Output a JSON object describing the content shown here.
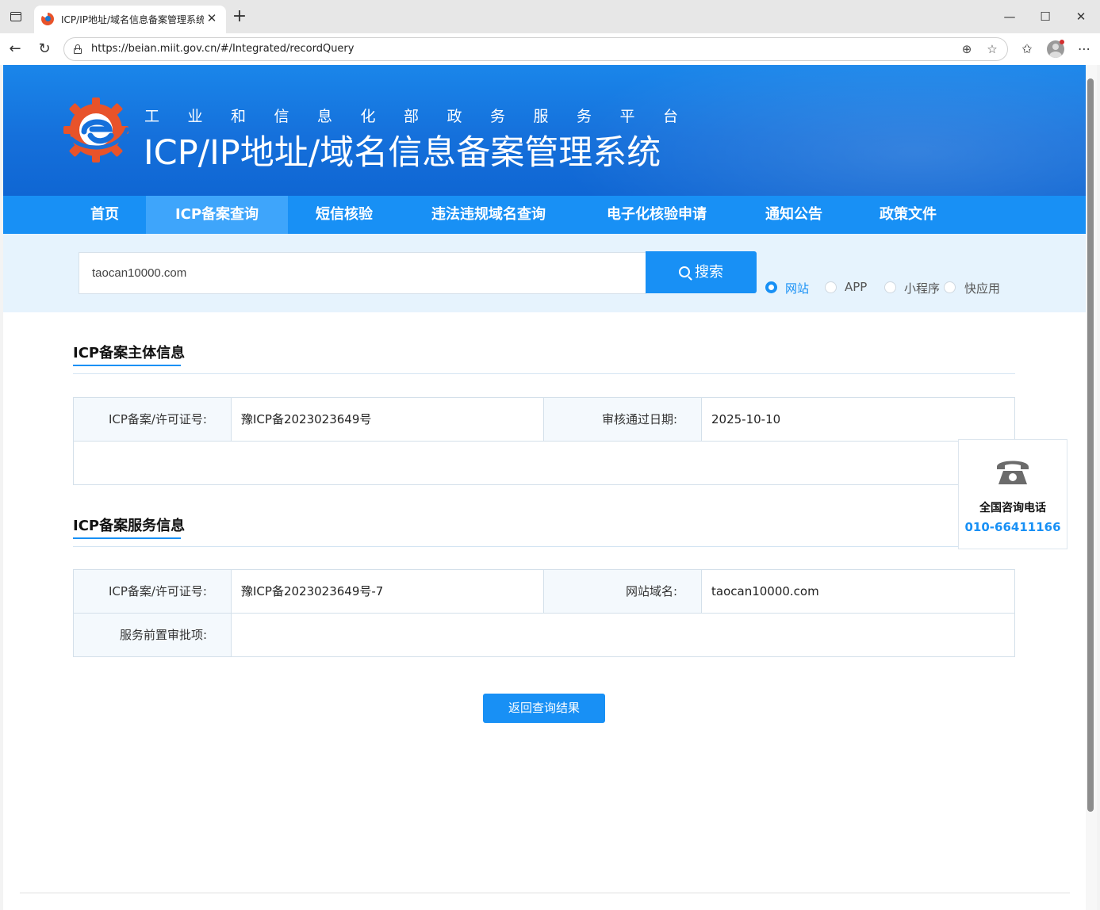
{
  "browser": {
    "tab_title": "ICP/IP地址/域名信息备案管理系统",
    "url": "https://beian.miit.gov.cn/#/Integrated/recordQuery",
    "new_tab": "+",
    "minimize": "—",
    "maximize": "☐",
    "close": "✕"
  },
  "header": {
    "subtitle": "工业和信息化部政务服务平台",
    "title": "ICP/IP地址/域名信息备案管理系统"
  },
  "nav": {
    "items": [
      {
        "label": "首页"
      },
      {
        "label": "ICP备案查询"
      },
      {
        "label": "短信核验"
      },
      {
        "label": "违法违规域名查询"
      },
      {
        "label": "电子化核验申请"
      },
      {
        "label": "通知公告"
      },
      {
        "label": "政策文件"
      }
    ],
    "active": "ICP备案查询"
  },
  "search": {
    "value": "taocan10000.com",
    "button_label": "搜索",
    "types": [
      {
        "label": "网站",
        "checked": true
      },
      {
        "label": "APP",
        "checked": false
      },
      {
        "label": "小程序",
        "checked": false
      },
      {
        "label": "快应用",
        "checked": false
      }
    ]
  },
  "subject_info": {
    "section_title": "ICP备案主体信息",
    "license_label": "ICP备案/许可证号:",
    "license_value": "豫ICP备2023023649号",
    "date_label": "审核通过日期:",
    "date_value": "2025-10-10"
  },
  "service_info": {
    "section_title": "ICP备案服务信息",
    "license_label": "ICP备案/许可证号:",
    "license_value": "豫ICP备2023023649号-7",
    "domain_label": "网站域名:",
    "domain_value": "taocan10000.com",
    "approval_label": "服务前置审批项:",
    "approval_value": ""
  },
  "back_button": "返回查询结果",
  "consult": {
    "title": "全国咨询电话",
    "phone": "010-66411166"
  },
  "colors": {
    "brand_blue": "#1890f5",
    "nav_active": "#3ea5fb",
    "banner_top": "#1a86ea",
    "search_bg": "#e6f3fd",
    "logo_orange": "#e8532a"
  }
}
